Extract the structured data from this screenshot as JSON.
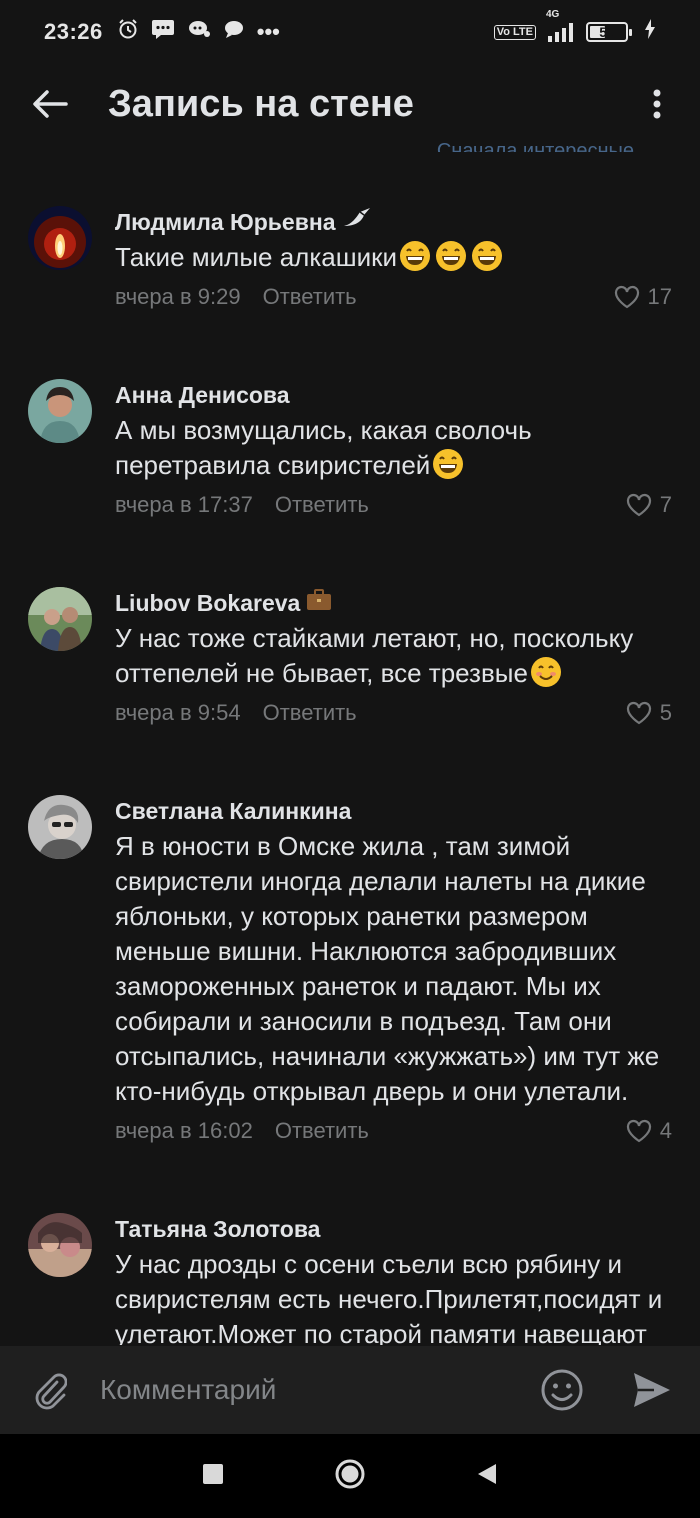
{
  "status_bar": {
    "time": "23:26",
    "more_dots": "•••",
    "network": "4G",
    "lte_label": "Vo LTE",
    "battery_level": 51,
    "battery_text": "51"
  },
  "header": {
    "title": "Запись на стене",
    "sort_peek": "Сначала интересные"
  },
  "comments": [
    {
      "author": "Людмила Юрьевна",
      "text": "Такие милые алкашики",
      "time": "вчера в 9:29",
      "reply": "Ответить",
      "likes": "17"
    },
    {
      "author": "Анна Денисова",
      "text": "А мы возмущались, какая сволочь перетравила свиристелей",
      "time": "вчера в 17:37",
      "reply": "Ответить",
      "likes": "7"
    },
    {
      "author": "Liubov Bokareva",
      "text": "У нас тоже стайками летают, но, поскольку оттепелей не бывает, все трезвые",
      "time": "вчера в 9:54",
      "reply": "Ответить",
      "likes": "5"
    },
    {
      "author": "Светлана Калинкина",
      "text": "Я в юности в Омске жила , там зимой свиристели иногда делали налеты на дикие яблоньки, у которых ранетки размером меньше вишни. Наклюются забродивших замороженных ранеток и падают. Мы их собирали и заносили в подъезд. Там они отсыпались, начинали «жужжать») им тут же кто-нибудь открывал дверь и они улетали.",
      "time": "вчера в 16:02",
      "reply": "Ответить",
      "likes": "4"
    },
    {
      "author": "Татьяна Золотова",
      "text": "У нас дрозды с осени съели всю рябину и свиристелям есть нечего.Прилетят,посидят и улетают.Может по старой памяти навещают нас? Раньше дроздов не было и рябина долго висела."
    }
  ],
  "input": {
    "placeholder": "Комментарий"
  },
  "colors": {
    "background": "#141414",
    "text": "#e1e3e6",
    "secondary": "#76787a",
    "accent": "#71aaeb"
  },
  "icons": [
    "back-arrow-icon",
    "more-vertical-icon",
    "heart-icon",
    "paperclip-icon",
    "smile-icon",
    "send-icon",
    "nav-square-icon",
    "nav-circle-icon",
    "nav-back-triangle-icon"
  ]
}
